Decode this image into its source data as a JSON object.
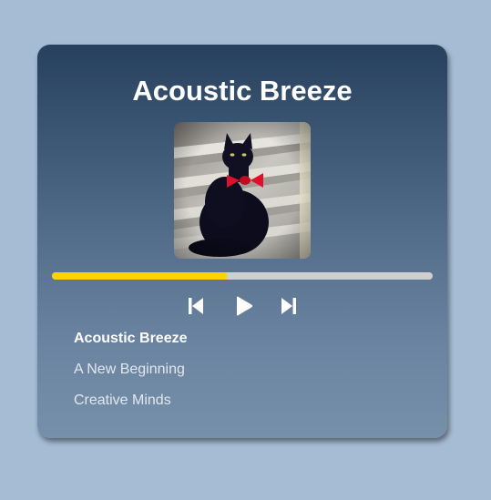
{
  "player": {
    "title": "Acoustic Breeze",
    "cover_icon": "black-cat-with-red-bowtie-photo",
    "progress_fraction": 0.46,
    "colors": {
      "progress_fill": "#ffd200",
      "progress_track": "#cfcfcf",
      "card_top": "#26405e",
      "card_bottom": "#7690aa",
      "page_background": "#a5bcd4"
    },
    "controls": {
      "prev_icon": "skip-previous-icon",
      "play_icon": "play-icon",
      "next_icon": "skip-next-icon"
    },
    "playlist": [
      {
        "label": "Acoustic Breeze",
        "active": true
      },
      {
        "label": "A New Beginning",
        "active": false
      },
      {
        "label": "Creative Minds",
        "active": false
      }
    ]
  }
}
